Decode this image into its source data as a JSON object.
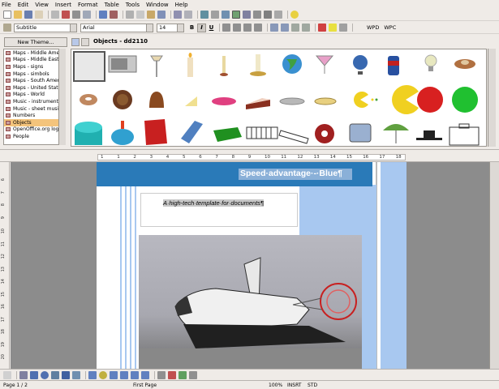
{
  "menu": [
    "File",
    "Edit",
    "View",
    "Insert",
    "Format",
    "Table",
    "Tools",
    "Window",
    "Help"
  ],
  "format_bar": {
    "style": "Subtitle",
    "font": "Arial",
    "size": "14",
    "wpd_label": "WPD",
    "wpc_label": "WPC"
  },
  "gallery": {
    "new_theme_label": "New Theme...",
    "objects_title": "Objects - dd2110",
    "themes": [
      "Maps - Middle Ame",
      "Maps - Middle East",
      "Maps - signs",
      "Maps - simbols",
      "Maps - South Amer",
      "Maps - United State",
      "Maps - World",
      "Music - instruments",
      "Music - sheet music",
      "Numbers",
      "Objects",
      "OpenOffice.org logo",
      "People"
    ],
    "selected_theme": "Objects",
    "objects": [
      "monitor",
      "microwave",
      "floor-lamp",
      "candle",
      "candlestick",
      "candle-holder",
      "globe",
      "cocktail-glass",
      "desk-globe",
      "soda-can",
      "light-bulb",
      "pin-cushion",
      "donut",
      "chocolate-cookie",
      "bell",
      "cheese",
      "pink-dish",
      "cake-slice",
      "bowl",
      "plate",
      "pacman-small",
      "pacman-large",
      "red-ball",
      "green-ball",
      "teal-cylinder",
      "spinning-top",
      "red-box",
      "blue-book",
      "green-book",
      "keyboard",
      "piano-keys",
      "spool",
      "tablet",
      "umbrella",
      "hat",
      "suitcase"
    ]
  },
  "ruler": {
    "ticks": [
      "1",
      "1",
      "2",
      "3",
      "4",
      "5",
      "6",
      "7",
      "8",
      "9",
      "10",
      "11",
      "12",
      "13",
      "14",
      "15",
      "16",
      "17",
      "18"
    ],
    "vticks": [
      "6",
      "7",
      "8",
      "9",
      "10",
      "11",
      "12",
      "13",
      "14",
      "15",
      "16",
      "17",
      "18",
      "19",
      "20"
    ]
  },
  "document": {
    "header_text": "Speed·advantage·-·Blue¶",
    "subtitle_text": "A·high-tech·template·for·documents¶",
    "image_alt": "space-shuttle-landing-photo"
  },
  "status": {
    "page": "Page 1 / 2",
    "page_style": "First Page",
    "zoom": "100%",
    "mode": "INSRT",
    "selection": "STD"
  }
}
